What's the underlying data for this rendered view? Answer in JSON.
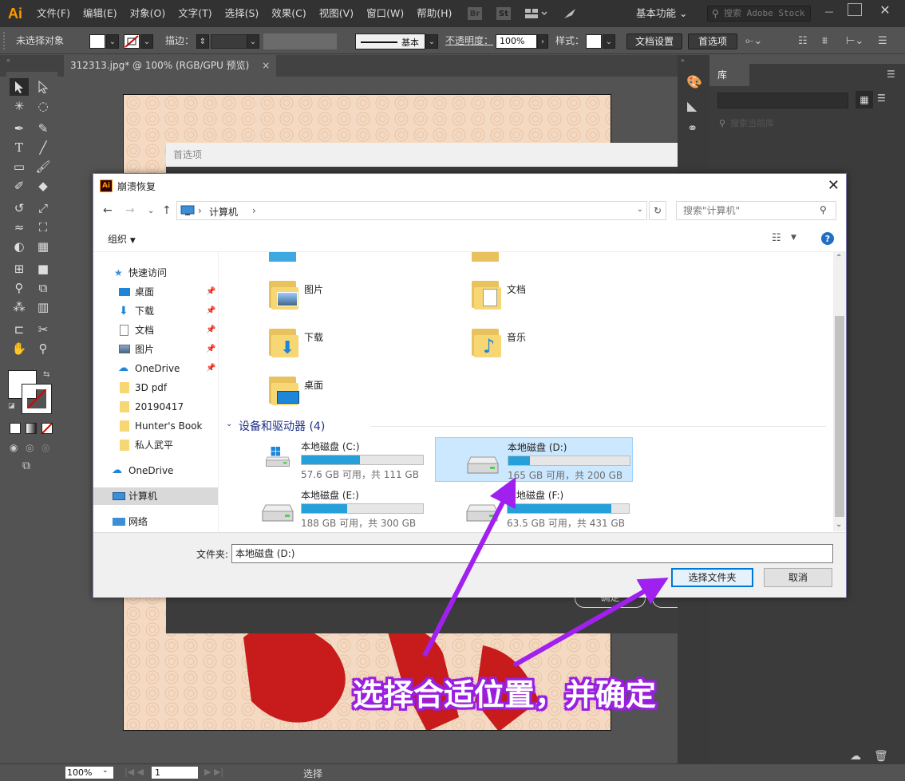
{
  "menubar": {
    "logo": "Ai",
    "items": [
      "文件(F)",
      "编辑(E)",
      "对象(O)",
      "文字(T)",
      "选择(S)",
      "效果(C)",
      "视图(V)",
      "窗口(W)",
      "帮助(H)"
    ],
    "bridge": "Br",
    "stock": "St",
    "workspace": "基本功能",
    "search_placeholder": "搜索 Adobe Stock"
  },
  "controlbar": {
    "selection": "未选择对象",
    "stroke_label": "描边：",
    "brush_label": "基本",
    "opacity_label": "不透明度：",
    "opacity_value": "100%",
    "style_label": "样式：",
    "doc_setup": "文档设置",
    "preferences": "首选项"
  },
  "tab": {
    "title": "312313.jpg* @ 100% (RGB/GPU 预览)",
    "close": "×"
  },
  "preferences_dialog": {
    "title": "首选项",
    "ok": "确定",
    "cancel": "取消"
  },
  "library_panel": {
    "title": "库",
    "search_placeholder": "搜索当前库"
  },
  "statusbar": {
    "zoom": "100%",
    "artboard": "1",
    "tool": "选择"
  },
  "dialog": {
    "title": "崩溃恢复",
    "address": "计算机",
    "search_placeholder": "搜索\"计算机\"",
    "organize": "组织",
    "nav": {
      "quick_access": "快速访问",
      "items": [
        {
          "label": "桌面",
          "pinned": true
        },
        {
          "label": "下载",
          "pinned": true
        },
        {
          "label": "文档",
          "pinned": true
        },
        {
          "label": "图片",
          "pinned": true
        },
        {
          "label": "OneDrive",
          "pinned": true
        },
        {
          "label": "3D pdf",
          "pinned": false
        },
        {
          "label": "20190417",
          "pinned": false
        },
        {
          "label": "Hunter's Book",
          "pinned": false
        },
        {
          "label": "私人武平",
          "pinned": false
        }
      ],
      "onedrive": "OneDrive",
      "computer": "计算机",
      "network": "网络"
    },
    "folders": [
      "图片",
      "文档",
      "下载",
      "音乐",
      "桌面"
    ],
    "drives_header": "设备和驱动器 (4)",
    "drives": [
      {
        "name": "本地磁盘 (C:)",
        "info": "57.6 GB 可用，共 111 GB",
        "used": 0.48,
        "selected": false
      },
      {
        "name": "本地磁盘 (D:)",
        "info": "165 GB 可用，共 200 GB",
        "used": 0.175,
        "selected": true
      },
      {
        "name": "本地磁盘 (E:)",
        "info": "188 GB 可用，共 300 GB",
        "used": 0.373,
        "selected": false
      },
      {
        "name": "本地磁盘 (F:)",
        "info": "63.5 GB 可用，共 431 GB",
        "used": 0.853,
        "selected": false
      }
    ],
    "folder_label": "文件夹:",
    "folder_value": "本地磁盘 (D:)",
    "select_button": "选择文件夹",
    "cancel_button": "取消"
  },
  "annotation": "选择合适位置，并确定",
  "colors": {
    "annotation_purple": "#9a1fe0",
    "drive_fill": "#26a0da",
    "ai_orange": "#ff9a00"
  }
}
